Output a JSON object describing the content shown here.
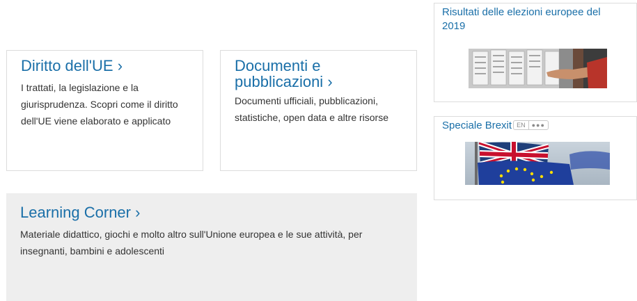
{
  "cards": {
    "diritto": {
      "title": "Diritto dell'UE",
      "description": "I trattati, la legislazione e la giurisprudenza. Scopri come il diritto dell'UE viene elaborato e applicato"
    },
    "documenti": {
      "title_line1": "Documenti e",
      "title_line2": "pubblicazioni",
      "description": "Documenti ufficiali, pubblicazioni, statistiche, open data e altre risorse"
    },
    "learning": {
      "title": "Learning Corner",
      "description": "Materiale didattico, giochi e molto altro sull'Unione europea e le sue attività, per insegnanti, bambini e adolescenti"
    },
    "chevron": "›"
  },
  "widgets": {
    "elezioni": {
      "title_line1": "Risultati delle elezioni europee del",
      "title_line2": "2019"
    },
    "brexit": {
      "title": "Speciale Brexit",
      "lang_code": "EN",
      "lang_more": "●●●"
    }
  },
  "colors": {
    "link": "#1a6fa8",
    "card_border": "#dcdcdc",
    "learning_bg": "#eeeeee",
    "eu_blue": "#1f3f9c",
    "eu_star": "#ffdd00",
    "uk_red": "#c8102e"
  }
}
